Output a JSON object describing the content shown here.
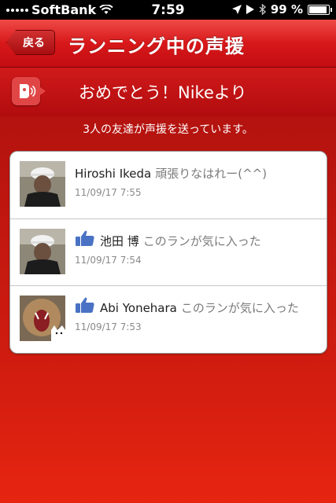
{
  "status_bar": {
    "carrier": "SoftBank",
    "time": "7:59",
    "battery_percent": "99 %",
    "battery_level": 0.99
  },
  "nav": {
    "back_label": "戻る",
    "title": "ランニング中の声援"
  },
  "banner": {
    "text": "おめでとう！Nikeより"
  },
  "summary": {
    "text": "3人の友達が声援を送っています。"
  },
  "cheers": [
    {
      "name": "Hiroshi Ikeda",
      "message": "頑張りなはれー(^^)",
      "time": "11/09/17  7:55",
      "liked": false
    },
    {
      "name": "池田 博",
      "message": "このランが気に入った",
      "time": "11/09/17  7:54",
      "liked": true
    },
    {
      "name": "Abi Yonehara",
      "message": "このランが気に入った",
      "time": "11/09/17  7:53",
      "liked": true
    }
  ],
  "colors": {
    "accent": "#d21d10",
    "nav_bar": "#d7181a",
    "like_blue": "#4a72c4"
  }
}
